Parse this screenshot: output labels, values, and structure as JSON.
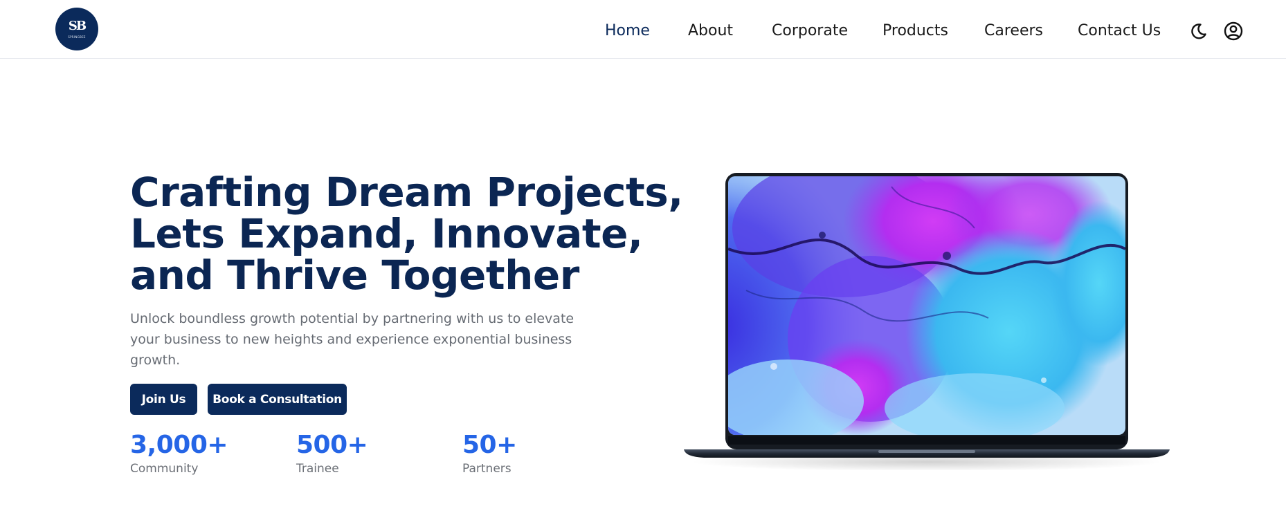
{
  "brand": {
    "logo_mark": "SB",
    "logo_text": "SPRINGBEE"
  },
  "nav": {
    "items": [
      {
        "label": "Home",
        "active": true
      },
      {
        "label": "About"
      },
      {
        "label": "Corporate"
      },
      {
        "label": "Products"
      },
      {
        "label": "Careers"
      },
      {
        "label": "Contact Us"
      }
    ],
    "icons": {
      "theme": "moon-icon",
      "account": "user-circle-icon"
    }
  },
  "hero": {
    "title_lines": [
      "Crafting Dream Projects,",
      "Lets Expand, Innovate,",
      "and Thrive Together"
    ],
    "subtitle": "Unlock boundless growth potential by partnering with us to elevate your business to new heights and experience exponential business growth.",
    "buttons": {
      "join": "Join Us",
      "consult": "Book a Consultation"
    }
  },
  "stats": [
    {
      "value": "3,000+",
      "label": "Community"
    },
    {
      "value": "500+",
      "label": "Trainee"
    },
    {
      "value": "50+",
      "label": "Partners"
    }
  ],
  "colors": {
    "navy": "#0b2a5b",
    "accent_blue": "#2565e6",
    "text_gray": "#666b73"
  }
}
